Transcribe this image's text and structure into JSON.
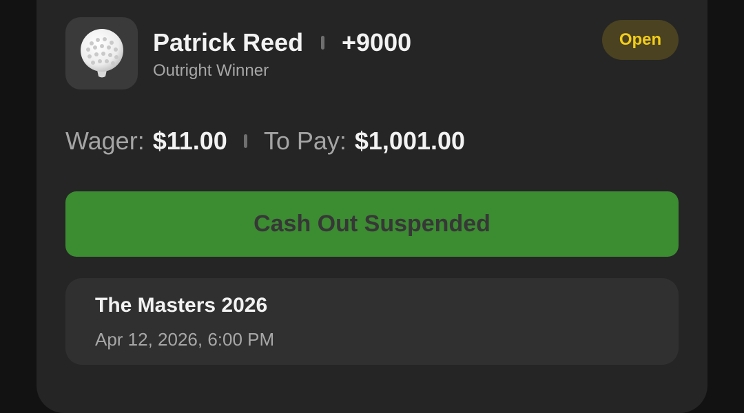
{
  "bet": {
    "icon": "golf-ball-on-tee-icon",
    "selection": "Patrick Reed",
    "odds": "+9000",
    "market": "Outright Winner",
    "status": "Open"
  },
  "wager": {
    "wager_label": "Wager:",
    "wager_value": "$11.00",
    "payout_label": "To Pay:",
    "payout_value": "$1,001.00"
  },
  "cashout": {
    "label": "Cash Out Suspended"
  },
  "event": {
    "name": "The Masters 2026",
    "datetime": "Apr 12, 2026, 6:00 PM"
  },
  "colors": {
    "accent_green": "#3c8c32",
    "status_yellow": "#f3cd1a",
    "status_bg": "#4a4220",
    "card_bg": "#252525"
  }
}
